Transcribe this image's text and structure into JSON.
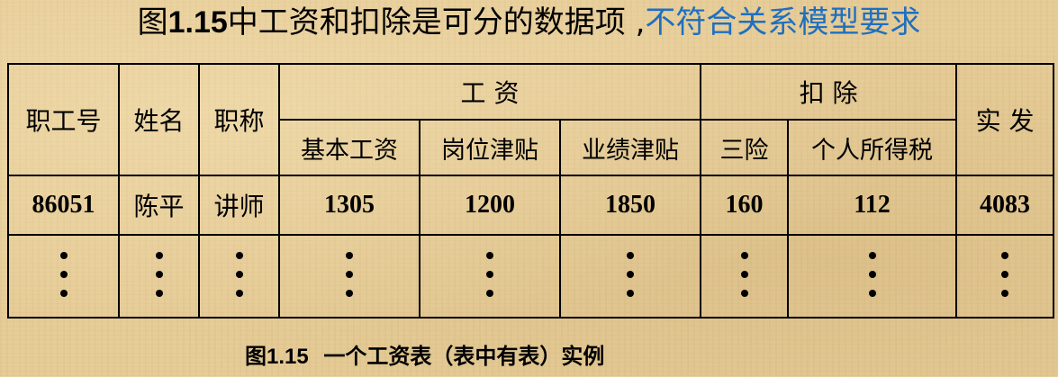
{
  "title": {
    "prefix": "图",
    "figure_number": "1.15",
    "main_text": "中工资和扣除是可分的数据项 ,",
    "highlight_text": "不符合关系模型要求",
    "highlight_color": "#1f6fc0"
  },
  "table": {
    "headers": {
      "employee_id": "职工号",
      "name": "姓名",
      "title": "职称",
      "salary_group": "工 资",
      "salary_sub": [
        "基本工资",
        "岗位津贴",
        "业绩津贴"
      ],
      "deduction_group": "扣 除",
      "deduction_sub": [
        "三险",
        "个人所得税"
      ],
      "net_pay": "实 发"
    },
    "rows": [
      {
        "employee_id": "86051",
        "name": "陈平",
        "title": "讲师",
        "base_salary": "1305",
        "post_allowance": "1200",
        "performance_allowance": "1850",
        "insurance": "160",
        "income_tax": "112",
        "net_pay": "4083"
      }
    ],
    "continuation_icon": "vertical-ellipsis-icon"
  },
  "caption": {
    "prefix": "图",
    "figure_number": "1.15",
    "text": "  一个工资表（表中有表）实例"
  }
}
